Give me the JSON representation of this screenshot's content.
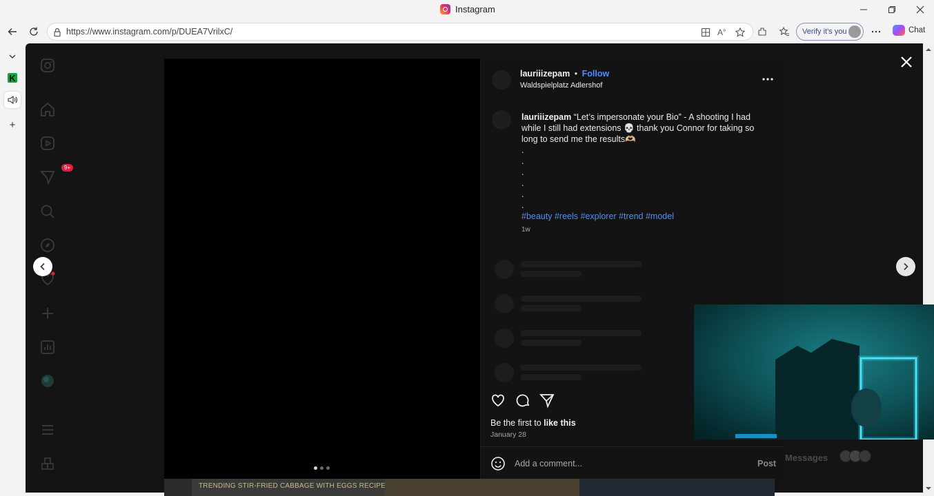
{
  "window": {
    "title": "Instagram",
    "controls": {
      "minimize": "–",
      "restore": "❐",
      "close": "✕"
    }
  },
  "browser": {
    "url": "https://www.instagram.com/p/DUEA7VrilxC/",
    "verify_label": "Verify it's you",
    "chat_label": "Chat"
  },
  "edge_sidebar": {
    "k_badge": "K",
    "add": "+"
  },
  "ig_nav": {
    "notification_count": "9+"
  },
  "post": {
    "author": "lauriiizepam",
    "follow_label": "Follow",
    "separator": "•",
    "location": "Waldspielplatz Adlershof",
    "caption_text": "“Let’s impersonate your Bio” - A shooting I had while I still had extensions 💀 thank you Connor for taking so long to send me the results🫶🏼",
    "caption_dots": [
      ".",
      ".",
      ".",
      ".",
      ".",
      "."
    ],
    "hashtags": "#beauty #reels #explorer #trend #model",
    "age": "1w",
    "likes_prefix": "Be the first to ",
    "likes_link": "like this",
    "date": "January 28",
    "comment_placeholder": "Add a comment...",
    "post_button": "Post"
  },
  "background": {
    "messages_label": "Messages",
    "video_caption": "TRENDING STIR-FRIED CABBAGE WITH EGGS RECIPE IN CHINA"
  },
  "colors": {
    "link_blue": "#4f8cff",
    "panel_bg": "#131313",
    "page_bg": "#141414",
    "notif_red": "#d8243a"
  }
}
